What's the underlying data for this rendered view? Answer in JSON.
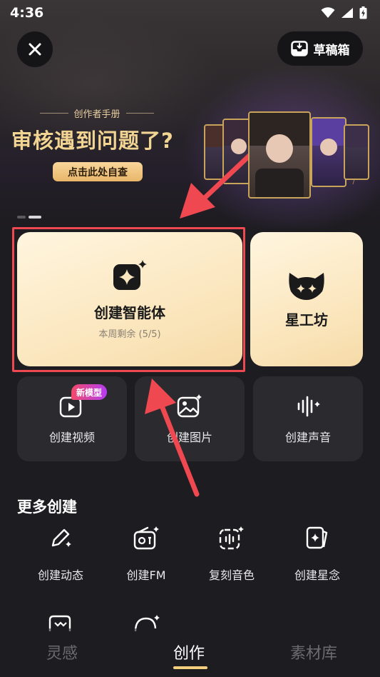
{
  "status_bar": {
    "time": "4:36"
  },
  "header": {
    "drafts_label": "草稿箱"
  },
  "banner": {
    "manual_label": "创作者手册",
    "headline": "审核遇到问题了?",
    "cta": "点击此处自查"
  },
  "main_tiles": {
    "create_agent": {
      "title": "创建智能体",
      "subtitle": "本周剩余 (5/5)"
    },
    "star_workshop": {
      "title": "星工坊"
    }
  },
  "quick_tiles": [
    {
      "label": "创建视频",
      "badge": "新模型",
      "icon": "video-sparkle-icon"
    },
    {
      "label": "创建图片",
      "icon": "image-sparkle-icon"
    },
    {
      "label": "创建声音",
      "icon": "sound-wave-icon"
    }
  ],
  "more_section": {
    "title": "更多创建",
    "items": [
      {
        "label": "创建动态",
        "icon": "pen-sparkle-icon"
      },
      {
        "label": "创建FM",
        "icon": "radio-icon"
      },
      {
        "label": "复刻音色",
        "icon": "voice-clone-icon"
      },
      {
        "label": "创建星念",
        "icon": "star-card-icon"
      }
    ]
  },
  "bottom_nav": {
    "tabs": [
      {
        "label": "灵感",
        "active": false
      },
      {
        "label": "创作",
        "active": true
      },
      {
        "label": "素材库",
        "active": false
      }
    ]
  },
  "colors": {
    "background": "#1d1c20",
    "accent_gold": "#f3d593",
    "highlight_red": "#ef4850",
    "tile_cream": "#fbe7bf",
    "tab_underline": "#f3cf7d"
  }
}
